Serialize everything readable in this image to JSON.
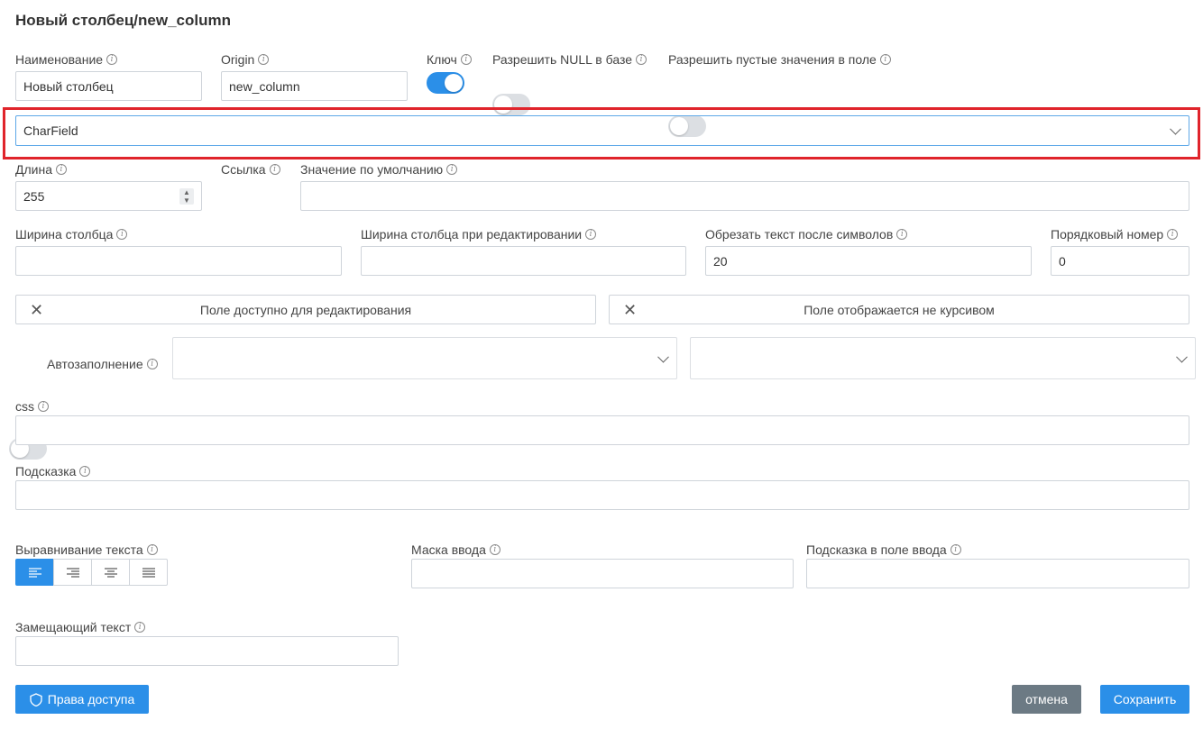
{
  "title": "Новый столбец/new_column",
  "fields": {
    "name": {
      "label": "Наименование",
      "value": "Новый столбец"
    },
    "origin": {
      "label": "Origin",
      "value": "new_column"
    },
    "key": {
      "label": "Ключ",
      "on": true
    },
    "allow_null": {
      "label": "Разрешить NULL в базе",
      "on": false
    },
    "allow_empty": {
      "label": "Разрешить пустые значения в поле",
      "on": false
    },
    "type": {
      "value": "CharField"
    },
    "length": {
      "label": "Длина",
      "value": "255"
    },
    "link": {
      "label": "Ссылка",
      "on": false
    },
    "default": {
      "label": "Значение по умолчанию",
      "value": ""
    },
    "col_width": {
      "label": "Ширина столбца",
      "value": ""
    },
    "col_width_edit": {
      "label": "Ширина столбца при редактировании",
      "value": ""
    },
    "truncate": {
      "label": "Обрезать текст после символов",
      "value": "20"
    },
    "order": {
      "label": "Порядковый номер",
      "value": "0"
    },
    "editable_chip": "Поле доступно для редактирования",
    "italic_chip": "Поле отображается не курсивом",
    "autofill": {
      "label": "Автозаполнение",
      "on": false
    },
    "css": {
      "label": "css",
      "value": ""
    },
    "hint": {
      "label": "Подсказка",
      "value": ""
    },
    "text_align": {
      "label": "Выравнивание текста",
      "selected": "left"
    },
    "input_mask": {
      "label": "Маска ввода",
      "value": ""
    },
    "input_hint": {
      "label": "Подсказка в поле ввода",
      "value": ""
    },
    "alt_text": {
      "label": "Замещающий текст",
      "value": ""
    }
  },
  "buttons": {
    "access": "Права доступа",
    "cancel": "отмена",
    "save": "Сохранить"
  },
  "colors": {
    "accent": "#2b8fe8",
    "highlight": "#e0242b",
    "cancel": "#6c7a84"
  },
  "icons": {
    "info": "info-icon",
    "close": "close-icon",
    "chevron": "chevron-down-icon",
    "shield": "shield-icon"
  }
}
